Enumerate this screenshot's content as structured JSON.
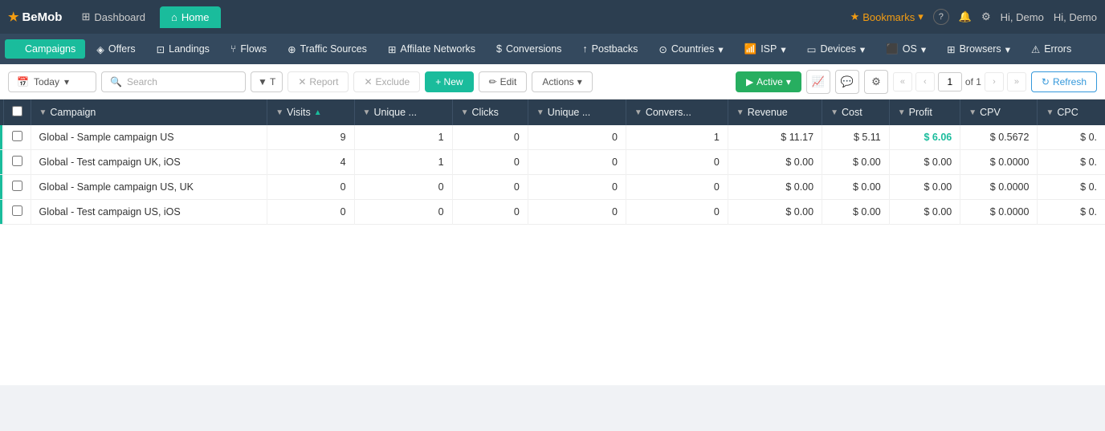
{
  "brand": {
    "name": "BeMob",
    "star": "★"
  },
  "topNav": {
    "tabs": [
      {
        "id": "dashboard",
        "label": "Dashboard",
        "icon": "⊞",
        "active": false
      },
      {
        "id": "home",
        "label": "Home",
        "icon": "⌂",
        "active": true
      }
    ],
    "right": {
      "bookmarks": "Bookmarks",
      "help": "?",
      "notifications": "🔔",
      "settings": "⚙",
      "user": "Hi, Demo"
    }
  },
  "menuBar": {
    "items": [
      {
        "id": "campaigns",
        "label": "Campaigns",
        "icon": "●",
        "active": true
      },
      {
        "id": "offers",
        "label": "Offers",
        "icon": "◈",
        "active": false
      },
      {
        "id": "landings",
        "label": "Landings",
        "icon": "⊡",
        "active": false
      },
      {
        "id": "flows",
        "label": "Flows",
        "icon": "⑂",
        "active": false
      },
      {
        "id": "traffic-sources",
        "label": "Traffic Sources",
        "icon": "⊕",
        "active": false
      },
      {
        "id": "affiliate-networks",
        "label": "Affilate Networks",
        "icon": "⊞",
        "active": false
      },
      {
        "id": "conversions",
        "label": "Conversions",
        "icon": "$",
        "active": false
      },
      {
        "id": "postbacks",
        "label": "Postbacks",
        "icon": "↑",
        "active": false
      },
      {
        "id": "countries",
        "label": "Countries",
        "icon": "⊙",
        "active": false
      },
      {
        "id": "isp",
        "label": "ISP",
        "icon": "📶",
        "active": false
      },
      {
        "id": "devices",
        "label": "Devices",
        "icon": "▭",
        "active": false
      },
      {
        "id": "os",
        "label": "OS",
        "icon": "⬛",
        "active": false
      },
      {
        "id": "browsers",
        "label": "Browsers",
        "icon": "⊞",
        "active": false
      },
      {
        "id": "errors",
        "label": "Errors",
        "icon": "⚠",
        "active": false
      }
    ]
  },
  "toolbar": {
    "date_label": "Today",
    "search_placeholder": "Search",
    "filter_label": "T",
    "report_label": "Report",
    "exclude_label": "Exclude",
    "new_label": "+ New",
    "edit_label": "Edit",
    "actions_label": "Actions",
    "active_label": "Active",
    "refresh_label": "Refresh",
    "page_current": "1",
    "page_total": "of 1"
  },
  "table": {
    "columns": [
      {
        "id": "campaign",
        "label": "Campaign",
        "sortable": true,
        "sorted": false
      },
      {
        "id": "visits",
        "label": "Visits",
        "sortable": true,
        "sorted": true,
        "sort_dir": "desc"
      },
      {
        "id": "unique_visits",
        "label": "Unique ...",
        "sortable": true,
        "sorted": false
      },
      {
        "id": "clicks",
        "label": "Clicks",
        "sortable": true,
        "sorted": false
      },
      {
        "id": "unique_clicks",
        "label": "Unique ...",
        "sortable": true,
        "sorted": false
      },
      {
        "id": "conversions",
        "label": "Convers...",
        "sortable": true,
        "sorted": false
      },
      {
        "id": "revenue",
        "label": "Revenue",
        "sortable": true,
        "sorted": false
      },
      {
        "id": "cost",
        "label": "Cost",
        "sortable": true,
        "sorted": false
      },
      {
        "id": "profit",
        "label": "Profit",
        "sortable": true,
        "sorted": false
      },
      {
        "id": "cpv",
        "label": "CPV",
        "sortable": true,
        "sorted": false
      },
      {
        "id": "cpc",
        "label": "CPC",
        "sortable": true,
        "sorted": false
      }
    ],
    "rows": [
      {
        "id": 1,
        "campaign": "Global - Sample campaign US",
        "visits": "9",
        "unique_visits": "1",
        "clicks": "0",
        "unique_clicks": "0",
        "conversions": "1",
        "revenue": "$ 11.17",
        "cost": "$ 5.11",
        "profit": "$ 6.06",
        "cpv": "$ 0.5672",
        "cpc": "$ 0.",
        "profit_positive": true,
        "indicator": true
      },
      {
        "id": 2,
        "campaign": "Global - Test campaign UK, iOS",
        "visits": "4",
        "unique_visits": "1",
        "clicks": "0",
        "unique_clicks": "0",
        "conversions": "0",
        "revenue": "$ 0.00",
        "cost": "$ 0.00",
        "profit": "$ 0.00",
        "cpv": "$ 0.0000",
        "cpc": "$ 0.",
        "profit_positive": false,
        "indicator": true
      },
      {
        "id": 3,
        "campaign": "Global - Sample campaign US, UK",
        "visits": "0",
        "unique_visits": "0",
        "clicks": "0",
        "unique_clicks": "0",
        "conversions": "0",
        "revenue": "$ 0.00",
        "cost": "$ 0.00",
        "profit": "$ 0.00",
        "cpv": "$ 0.0000",
        "cpc": "$ 0.",
        "profit_positive": false,
        "indicator": true
      },
      {
        "id": 4,
        "campaign": "Global - Test campaign US, iOS",
        "visits": "0",
        "unique_visits": "0",
        "clicks": "0",
        "unique_clicks": "0",
        "conversions": "0",
        "revenue": "$ 0.00",
        "cost": "$ 0.00",
        "profit": "$ 0.00",
        "cpv": "$ 0.0000",
        "cpc": "$ 0.",
        "profit_positive": false,
        "indicator": true
      }
    ]
  }
}
